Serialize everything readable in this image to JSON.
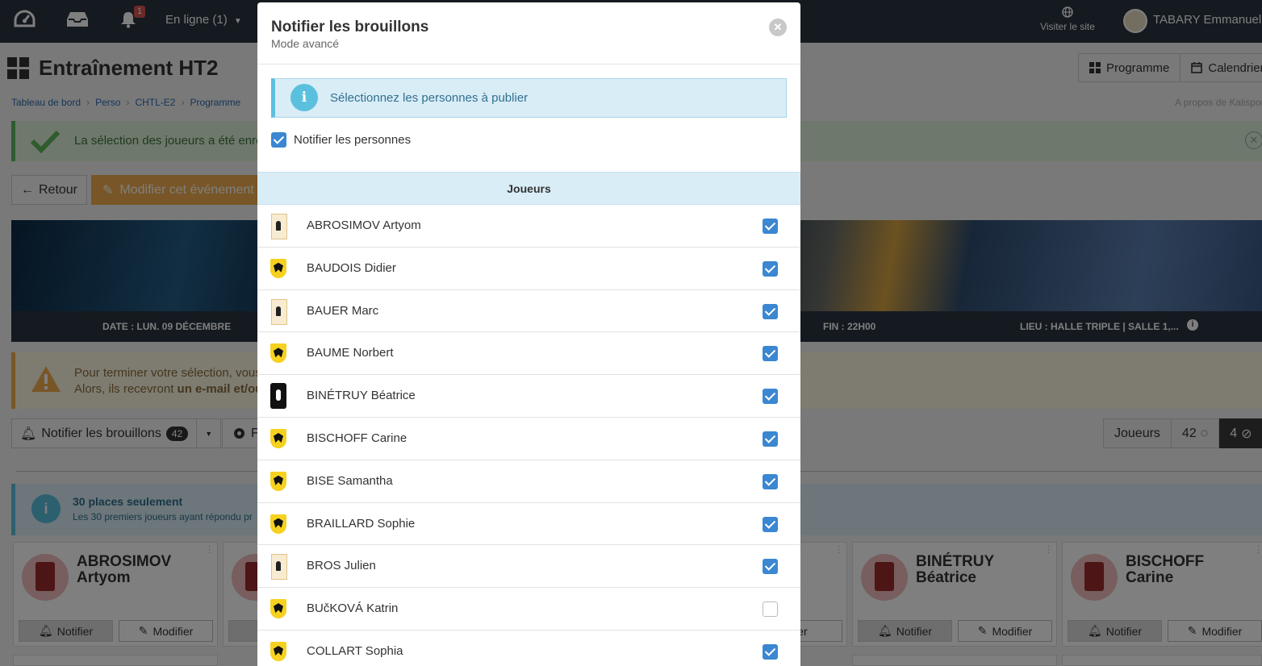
{
  "topbar": {
    "notifications_count": "1",
    "online_label": "En ligne (1)",
    "visit_label": "Visiter le site",
    "user_name": "TABARY Emmanuel"
  },
  "page": {
    "title": "Entraînement HT2",
    "view_buttons": [
      "Programme",
      "Calendrier"
    ]
  },
  "breadcrumb": [
    "Tableau de bord",
    "Perso",
    "CHTL-E2",
    "Programme"
  ],
  "about_label": "A propos de Kalisport",
  "alerts": {
    "success": "La sélection des joueurs a été enregistrée",
    "warning_line1": "Pour terminer votre sélection, vous",
    "warning_line2_pre": "Alors, ils recevront ",
    "warning_line2_bold": "un e-mail et/ou",
    "info_title": "30 places seulement",
    "info_text": "Les 30 premiers joueurs ayant répondu pr"
  },
  "actions": {
    "back_label": "Retour",
    "edit_label": "Modifier cet événement",
    "notify_label": "Notifier les brouillons",
    "notify_count": "42",
    "f_label": "F"
  },
  "event_bar": {
    "date": "DATE : LUN. 09 DÉCEMBRE",
    "end": "FIN : 22H00",
    "place": "LIEU : HALLE TRIPLE | SALLE 1,..."
  },
  "stats": {
    "players_label": "Joueurs",
    "pending": "42",
    "declined": "4"
  },
  "cards": [
    {
      "last": "ABROSIMOV",
      "first": "Artyom"
    },
    {
      "last": "BINÉTRUY",
      "first": "Béatrice"
    },
    {
      "last": "BISCHOFF",
      "first": "Carine"
    }
  ],
  "card_buttons": {
    "notify": "Notifier",
    "modify": "Modifier",
    "modify_partial": "difier"
  },
  "modal": {
    "title": "Notifier les brouillons",
    "subtitle": "Mode avancé",
    "info_text": "Sélectionnez les personnes à publier",
    "notify_persons_label": "Notifier les personnes",
    "notify_persons_checked": true,
    "table_header": "Joueurs",
    "players": [
      {
        "name": "ABROSIMOV Artyom",
        "checked": true,
        "logo": "jersey"
      },
      {
        "name": "BAUDOIS Didier",
        "checked": true,
        "logo": "crest"
      },
      {
        "name": "BAUER Marc",
        "checked": true,
        "logo": "jersey"
      },
      {
        "name": "BAUME Norbert",
        "checked": true,
        "logo": "crest"
      },
      {
        "name": "BINÉTRUY Béatrice",
        "checked": true,
        "logo": "dark"
      },
      {
        "name": "BISCHOFF Carine",
        "checked": true,
        "logo": "crest"
      },
      {
        "name": "BISE Samantha",
        "checked": true,
        "logo": "crest"
      },
      {
        "name": "BRAILLARD Sophie",
        "checked": true,
        "logo": "crest"
      },
      {
        "name": "BROS Julien",
        "checked": true,
        "logo": "jersey"
      },
      {
        "name": "BUčKOVÁ Katrin",
        "checked": false,
        "logo": "crest"
      },
      {
        "name": "COLLART Sophia",
        "checked": true,
        "logo": "crest"
      }
    ]
  },
  "colors": {
    "topbar": "#2b3541",
    "checkbox_on": "#3b87d1",
    "info_bg": "#d9edf7",
    "success_bg": "#dff0d8",
    "warning_bg": "#fcf8e3",
    "edit_button": "#f0ad4e"
  }
}
